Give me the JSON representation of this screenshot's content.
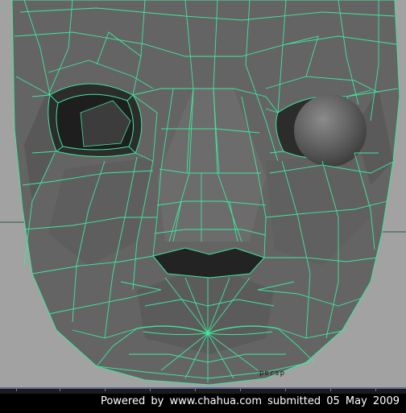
{
  "viewport": {
    "camera_label": "persp",
    "background_color": "#a2a2a2",
    "mesh_fill": "#646464",
    "wire_color": "#3fe79b",
    "eye_sphere_color": "#6e6e6e"
  },
  "footer": {
    "credit": "Powered  by  www.chahua.com  submitted  05  May  2009"
  }
}
